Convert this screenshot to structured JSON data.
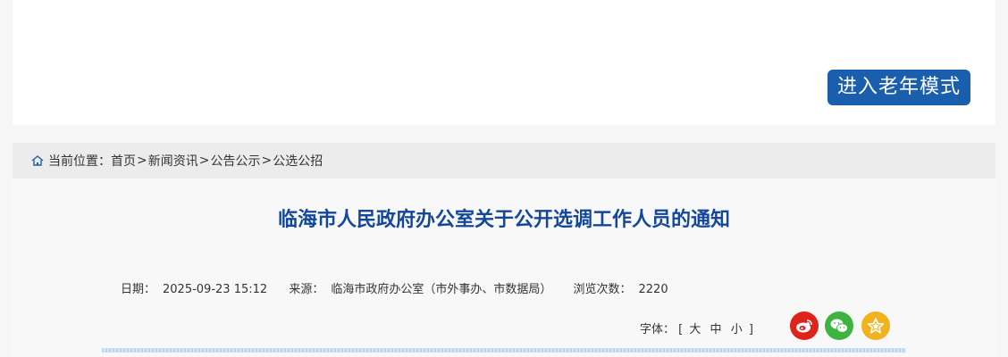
{
  "elder_mode": {
    "label": "进入老年模式"
  },
  "breadcrumb": {
    "prefix": "当前位置：",
    "items": [
      "首页",
      "新闻资讯",
      "公告公示",
      "公选公招"
    ],
    "separator": ">"
  },
  "article": {
    "title": "临海市人民政府办公室关于公开选调工作人员的通知",
    "date_label": "日期：",
    "date_value": "2025-09-23 15:12",
    "source_label": "来源：",
    "source_value": "临海市政府办公室（市外事办、市数据局）",
    "views_label": "浏览次数：",
    "views_value": "2220"
  },
  "font_size": {
    "label": "字体：",
    "open": "[",
    "options": [
      "大",
      "中",
      "小"
    ],
    "close": "]"
  },
  "share": {
    "weibo_color": "#e0221c",
    "wechat_color": "#3fb33f",
    "favorite_color": "#f2b21d"
  },
  "colors": {
    "accent": "#1a5fae",
    "title": "#13479a"
  }
}
